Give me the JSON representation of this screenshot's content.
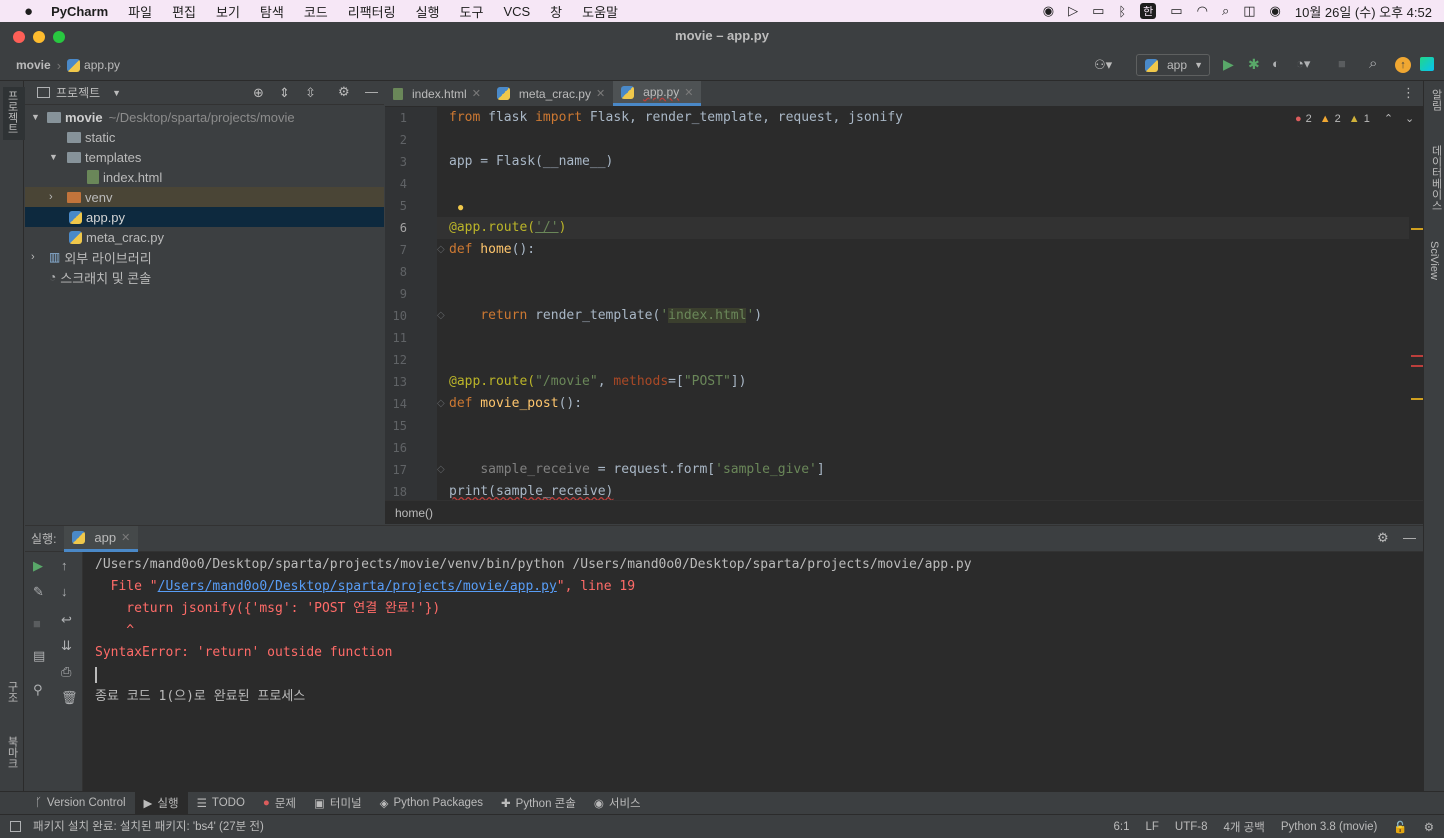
{
  "macbar": {
    "app_name": "PyCharm",
    "menus": [
      "파일",
      "편집",
      "보기",
      "탐색",
      "코드",
      "리팩터링",
      "실행",
      "도구",
      "VCS",
      "창",
      "도움말"
    ],
    "clock": "10월 26일 (수) 오후 4:52",
    "input_method": "한"
  },
  "window": {
    "title": "movie – app.py"
  },
  "nav": {
    "project": "movie",
    "file": "app.py",
    "run_config": "app"
  },
  "left_strip": {
    "project_label": "프로젝트",
    "structure_label": "구조",
    "bookmarks_label": "북마크"
  },
  "right_strip": {
    "notifications_label": "알림",
    "database_label": "데이터베이스",
    "sciview_label": "SciView"
  },
  "project_panel": {
    "title": "프로젝트",
    "root_name": "movie",
    "root_path": "~/Desktop/sparta/projects/movie",
    "items": {
      "static": "static",
      "templates": "templates",
      "index_html": "index.html",
      "venv": "venv",
      "app_py": "app.py",
      "meta_crac_py": "meta_crac.py",
      "external_libs": "외부 라이브러리",
      "scratches": "스크래치 및 콘솔"
    }
  },
  "editor": {
    "tabs": {
      "t1": "index.html",
      "t2": "meta_crac.py",
      "t3": "app.py"
    },
    "inspections": {
      "errors": "2",
      "warnings": "2",
      "weak": "1"
    },
    "line_numbers": [
      "1",
      "2",
      "3",
      "4",
      "5",
      "6",
      "7",
      "8",
      "9",
      "10",
      "11",
      "12",
      "13",
      "14",
      "15",
      "16",
      "17",
      "18"
    ],
    "breadcrumb": "home()"
  },
  "code": {
    "l1": {
      "kw1": "from",
      "mod": " flask ",
      "kw2": "import",
      "rest": " Flask, render_template, request, jsonify"
    },
    "l3": {
      "text": "app = Flask(__name__)"
    },
    "l6": {
      "dec": "@app.route(",
      "str": "'/'",
      "close": ")"
    },
    "l7": {
      "kw": "def",
      "fn": " home",
      "rest": "():"
    },
    "l10": {
      "indent": "    ",
      "kw": "return",
      "call": " render_template(",
      "q1": "'",
      "str": "index.html",
      "q2": "'",
      "close": ")"
    },
    "l13": {
      "dec": "@app.route(",
      "str": "\"/movie\"",
      "comma": ", ",
      "prm": "methods",
      "eq": "=[",
      "str2": "\"POST\"",
      "close": "])"
    },
    "l14": {
      "kw": "def",
      "fn": " movie_post",
      "rest": "():"
    },
    "l17": {
      "indent": "    ",
      "var": "sample_receive",
      "rest": " = request.form[",
      "str": "'sample_give'",
      "close": "]"
    },
    "l18": {
      "text": "print(sample_receive)"
    }
  },
  "run": {
    "label": "실행:",
    "tab": "app",
    "lines": {
      "cmd": "/Users/mand0o0/Desktop/sparta/projects/movie/venv/bin/python /Users/mand0o0/Desktop/sparta/projects/movie/app.py",
      "file_pre": "  File \"",
      "file_link": "/Users/mand0o0/Desktop/sparta/projects/movie/app.py",
      "file_post": "\", line 19",
      "src": "    return jsonify({'msg': 'POST 연결 완료!'})",
      "caret": "    ^",
      "error": "SyntaxError: 'return' outside function",
      "exit": "종료 코드 1(으)로 완료된 프로세스"
    }
  },
  "bottom_tools": {
    "vcs": "Version Control",
    "run": "실행",
    "todo": "TODO",
    "problems": "문제",
    "terminal": "터미널",
    "packages": "Python Packages",
    "console": "Python 콘솔",
    "services": "서비스"
  },
  "status": {
    "message": "패키지 설치 완료: 설치된 패키지: 'bs4' (27분 전)",
    "position": "6:1",
    "line_sep": "LF",
    "encoding": "UTF-8",
    "indent": "4개 공백",
    "interpreter": "Python 3.8 (movie)"
  },
  "colors": {
    "accent": "#4a88c7",
    "error": "#ff6b68",
    "link": "#589df6"
  }
}
